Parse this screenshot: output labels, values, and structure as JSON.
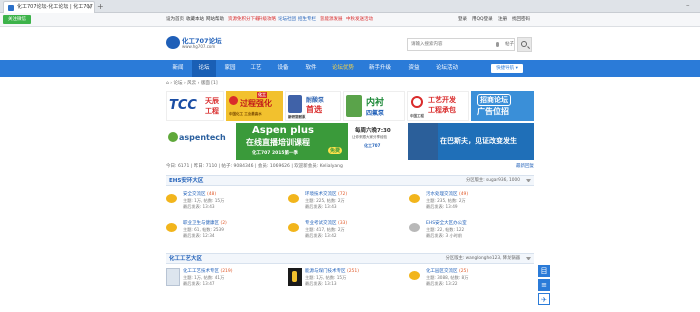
{
  "browser": {
    "tab_title": "化工707论坛-化工论坛 | 化工707",
    "tab_close": "×",
    "new_tab": "+",
    "minimize": "–",
    "green_button": "关注微信"
  },
  "toplinks": {
    "left": [
      {
        "label": "设为首页",
        "color": "#1f5fb8"
      },
      {
        "label": "收藏本站",
        "color": "#1f5fb8"
      },
      {
        "label": "网站帮助",
        "color": "#333333"
      },
      {
        "label": "资源免积分下载",
        "color": "#d92b2b"
      },
      {
        "label": "升级攻略",
        "color": "#d92b2b"
      },
      {
        "label": "论坛社团",
        "color": "#1f5fb8"
      },
      {
        "label": "招生专栏",
        "color": "#1f5fb8"
      },
      {
        "label": "氢能源发展",
        "color": "#d92b2b"
      },
      {
        "label": "中秋发送活动",
        "color": "#d92b2b"
      }
    ],
    "right": [
      "登录",
      "用QQ登录",
      "注册",
      "找回密码"
    ]
  },
  "header": {
    "logo_text": "化工707论坛",
    "logo_url": "www.hg707.com",
    "search_placeholder": "请输入搜索内容",
    "search_type": "帖子",
    "search_button": "搜索"
  },
  "nav": {
    "items": [
      "新闻",
      "论坛",
      "家园",
      "工艺",
      "设备",
      "软件",
      "论坛优势",
      "新手升级",
      "资益",
      "论坛活动"
    ],
    "active_index": 1,
    "quick_nav": "快捷导航 ▾"
  },
  "breadcrumb": "⌂ › 论坛 › 风云 › 版面 [1]",
  "banners": [
    {
      "id": "tcc",
      "lines": [
        "TCC",
        "天辰",
        "工程"
      ]
    },
    {
      "id": "process",
      "lines": [
        "化工",
        "过程强化",
        "中国化工 工业最高水"
      ]
    },
    {
      "id": "pump",
      "lines": [
        "耐酸泵",
        "首选",
        "新研常耐泵"
      ]
    },
    {
      "id": "lining",
      "lines": [
        "内衬",
        "四氟泵"
      ]
    },
    {
      "id": "engineering",
      "lines": [
        "工艺开发",
        "工程承包",
        "中国工程"
      ]
    },
    {
      "id": "ad",
      "lines": [
        "招商论坛",
        "广告位招"
      ]
    },
    {
      "id": "aspentech",
      "lines": [
        "aspentech"
      ]
    },
    {
      "id": "aspenplus",
      "lines": [
        "Aspen plus",
        "在线直播培训课程",
        "化工707   2015第一季",
        "免费"
      ]
    },
    {
      "id": "schedule",
      "lines": [
        "每周六晚7:30",
        "让你来跟大家分享经验",
        "化工707"
      ]
    },
    {
      "id": "basf",
      "lines": [
        "在巴斯夫，见证改变发生"
      ]
    }
  ],
  "stats": {
    "text": "今日: 6171 | 昨日: 7110 | 帖子: 9084346 | 会员: 1069626 | 欢迎新会员: Kelialyang",
    "right": "最新回复"
  },
  "sections": [
    {
      "title": "EHS安环大区",
      "moderators": "分区版主: sugar936, 1000",
      "boards": [
        {
          "name": "安全交流区",
          "count": "(48)",
          "topics": "主题: 1万, 帖数: 15万",
          "last": "最后发表: 13:43",
          "icon": "yellow"
        },
        {
          "name": "环境技术交流区",
          "count": "(72)",
          "topics": "主题: 225, 帖数: 2万",
          "last": "最后发表: 13:43",
          "icon": "yellow"
        },
        {
          "name": "污水处理交流区",
          "count": "(49)",
          "topics": "主题: 235, 帖数: 2万",
          "last": "最后发表: 13:49",
          "icon": "yellow"
        },
        {
          "name": "职业卫生与健康区",
          "count": "(2)",
          "topics": "主题: 61, 帖数: 2539",
          "last": "最后发表: 12:34",
          "icon": "yellow"
        },
        {
          "name": "专业考试交流区",
          "count": "(33)",
          "topics": "主题: 417, 帖数: 2万",
          "last": "最后发表: 13:42",
          "icon": "yellow"
        },
        {
          "name": "EHS安全大区办公室",
          "count": "",
          "topics": "主题: 22, 帖数: 122",
          "last": "最后发表: 3 小时前",
          "icon": "gray"
        }
      ]
    },
    {
      "title": "化工工艺大区",
      "moderators": "分区版主: wanglonghe123, 降龙锅器",
      "boards": [
        {
          "name": "化工工艺技术专区",
          "count": "(219)",
          "topics": "主题: 1万, 帖数: 41万",
          "last": "最后发表: 13:47",
          "icon": "thumb-chem"
        },
        {
          "name": "能源与煤门技术专区",
          "count": "(251)",
          "topics": "主题: 1万, 帖数: 15万",
          "last": "最后发表: 13:13",
          "icon": "thumb-dark"
        },
        {
          "name": "化工园区交流区",
          "count": "(25)",
          "topics": "主题: 3088, 帖数: 8万",
          "last": "最后发表: 13:22",
          "icon": "yellow"
        }
      ]
    }
  ],
  "right_float": [
    "目",
    "≡",
    "✈"
  ],
  "colors": {
    "nav": "#2b7bd8",
    "nav_active": "#1a5fb5",
    "link": "#1f5fb8",
    "hot": "#d92b2b"
  }
}
